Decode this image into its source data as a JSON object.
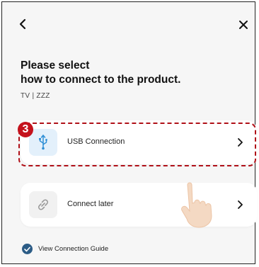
{
  "header": {
    "back_icon": "chevron-left-icon",
    "close_icon": "close-icon"
  },
  "title": {
    "line1": "Please select",
    "line2": "how to connect to the product."
  },
  "device": {
    "label": "TV | ZZZ"
  },
  "options": [
    {
      "label": "USB Connection",
      "icon": "usb-icon",
      "icon_bg": "#e3f0fb",
      "icon_color": "#2f8fd6"
    },
    {
      "label": "Connect later",
      "icon": "link-icon",
      "icon_bg": "#f1f1f1",
      "icon_color": "#9a9a9a"
    }
  ],
  "annotation": {
    "step_number": "3",
    "highlight_color": "#b01018",
    "badge_color": "#c4121c"
  },
  "footer": {
    "guide_label": "View Connection Guide",
    "check_color": "#2c5c86"
  },
  "colors": {
    "background": "#f6f6f6",
    "card": "#ffffff"
  }
}
